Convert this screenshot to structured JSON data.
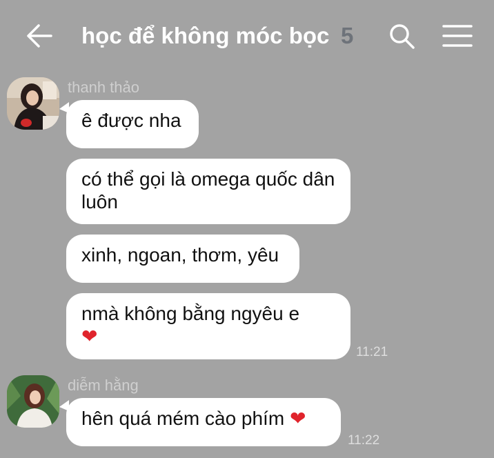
{
  "header": {
    "title": "học để không móc bọc",
    "member_count": "5",
    "back_icon": "arrow-left-icon",
    "search_icon": "search-icon",
    "menu_icon": "hamburger-menu-icon"
  },
  "messages": [
    {
      "sender": "thanh thảo",
      "bubbles": [
        {
          "text": "ê được nha"
        },
        {
          "text": "có thể gọi là omega quốc dân luôn"
        },
        {
          "text": "xinh, ngoan, thơm, yêu"
        },
        {
          "text": "nmà không bằng ngyêu e",
          "emoji": "❤"
        }
      ],
      "time": "11:21"
    },
    {
      "sender": "diễm hằng",
      "bubbles": [
        {
          "text": "hên quá mém cào phím",
          "emoji": "❤"
        }
      ],
      "time": "11:22"
    }
  ],
  "colors": {
    "background": "#a3a3a3",
    "bubble": "#ffffff",
    "member_count": "#6e737a",
    "heart": "#e0242c"
  }
}
